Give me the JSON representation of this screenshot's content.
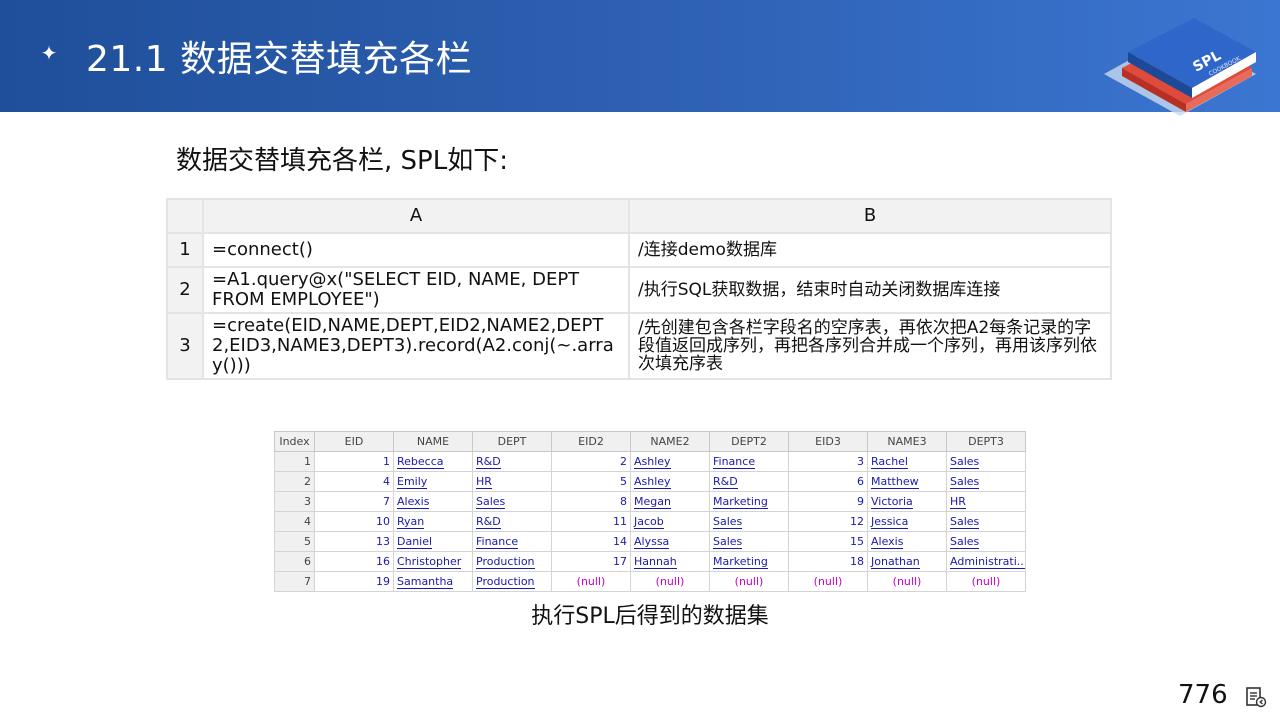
{
  "header": {
    "title": "21.1 数据交替填充各栏",
    "logo_text": "SPL",
    "logo_subtext": "COOKBOOK"
  },
  "subtitle": "数据交替填充各栏, SPL如下:",
  "code_grid": {
    "columns": [
      "A",
      "B"
    ],
    "rows": [
      {
        "num": "1",
        "a": "=connect()",
        "b": "/连接demo数据库"
      },
      {
        "num": "2",
        "a": "=A1.query@x(\"SELECT EID, NAME, DEPT FROM EMPLOYEE\")",
        "b": "/执行SQL获取数据，结束时自动关闭数据库连接"
      },
      {
        "num": "3",
        "a": "=create(EID,NAME,DEPT,EID2,NAME2,DEPT2,EID3,NAME3,DEPT3).record(A2.conj(~.array()))",
        "b": "/先创建包含各栏字段名的空序表，再依次把A2每条记录的字段值返回成序列，再把各序列合并成一个序列，再用该序列依次填充序表"
      }
    ]
  },
  "result_table": {
    "headers": [
      "Index",
      "EID",
      "NAME",
      "DEPT",
      "EID2",
      "NAME2",
      "DEPT2",
      "EID3",
      "NAME3",
      "DEPT3"
    ],
    "rows": [
      [
        "1",
        "1",
        "Rebecca",
        "R&D",
        "2",
        "Ashley",
        "Finance",
        "3",
        "Rachel",
        "Sales"
      ],
      [
        "2",
        "4",
        "Emily",
        "HR",
        "5",
        "Ashley",
        "R&D",
        "6",
        "Matthew",
        "Sales"
      ],
      [
        "3",
        "7",
        "Alexis",
        "Sales",
        "8",
        "Megan",
        "Marketing",
        "9",
        "Victoria",
        "HR"
      ],
      [
        "4",
        "10",
        "Ryan",
        "R&D",
        "11",
        "Jacob",
        "Sales",
        "12",
        "Jessica",
        "Sales"
      ],
      [
        "5",
        "13",
        "Daniel",
        "Finance",
        "14",
        "Alyssa",
        "Sales",
        "15",
        "Alexis",
        "Sales"
      ],
      [
        "6",
        "16",
        "Christopher",
        "Production",
        "17",
        "Hannah",
        "Marketing",
        "18",
        "Jonathan",
        "Administrati..."
      ],
      [
        "7",
        "19",
        "Samantha",
        "Production",
        "(null)",
        "(null)",
        "(null)",
        "(null)",
        "(null)",
        "(null)"
      ]
    ]
  },
  "caption": "执行SPL后得到的数据集",
  "page_number": "776",
  "colors": {
    "header_bg": "#2f62b5",
    "value_blue": "#1a1aa8",
    "null_magenta": "#c800c8"
  }
}
